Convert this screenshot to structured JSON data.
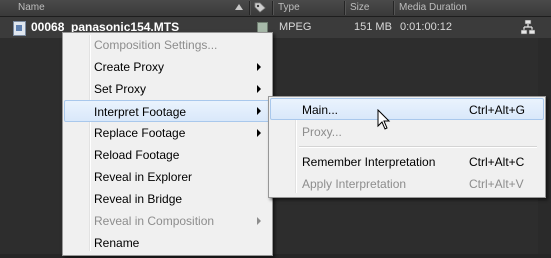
{
  "columns": {
    "name": "Name",
    "type": "Type",
    "size": "Size",
    "media_duration": "Media Duration"
  },
  "row": {
    "name": "00068_panasonic154.MTS",
    "type": "MPEG",
    "size": "151 MB",
    "duration": "0:01:00:12"
  },
  "context_menu": {
    "items": [
      {
        "label": "Composition Settings...",
        "enabled": false,
        "submenu": false
      },
      {
        "label": "Create Proxy",
        "enabled": true,
        "submenu": true
      },
      {
        "label": "Set Proxy",
        "enabled": true,
        "submenu": true
      },
      {
        "label": "Interpret Footage",
        "enabled": true,
        "submenu": true,
        "highlighted": true
      },
      {
        "label": "Replace Footage",
        "enabled": true,
        "submenu": true
      },
      {
        "label": "Reload Footage",
        "enabled": true,
        "submenu": false
      },
      {
        "label": "Reveal in Explorer",
        "enabled": true,
        "submenu": false
      },
      {
        "label": "Reveal in Bridge",
        "enabled": true,
        "submenu": false
      },
      {
        "label": "Reveal in Composition",
        "enabled": false,
        "submenu": true
      },
      {
        "label": "Rename",
        "enabled": true,
        "submenu": false
      }
    ]
  },
  "submenu": {
    "items": [
      {
        "label": "Main...",
        "shortcut": "Ctrl+Alt+G",
        "enabled": true,
        "highlighted": true
      },
      {
        "label": "Proxy...",
        "shortcut": "",
        "enabled": false
      },
      {
        "label": "Remember Interpretation",
        "shortcut": "Ctrl+Alt+C",
        "enabled": true
      },
      {
        "label": "Apply Interpretation",
        "shortcut": "Ctrl+Alt+V",
        "enabled": false
      }
    ]
  },
  "colors": {
    "panel_bg": "#2d2d2d",
    "row_bg": "#3b3b3b",
    "menu_bg": "#f0f0f0",
    "highlight": "#d9e8fa",
    "disabled_text": "#8d8d8d",
    "label_swatch": "#a7b9a9"
  },
  "icons": [
    "sort-ascending-icon",
    "label-tag-icon",
    "footage-file-icon",
    "submenu-arrow-icon",
    "flowchart-icon",
    "mouse-pointer-icon"
  ]
}
